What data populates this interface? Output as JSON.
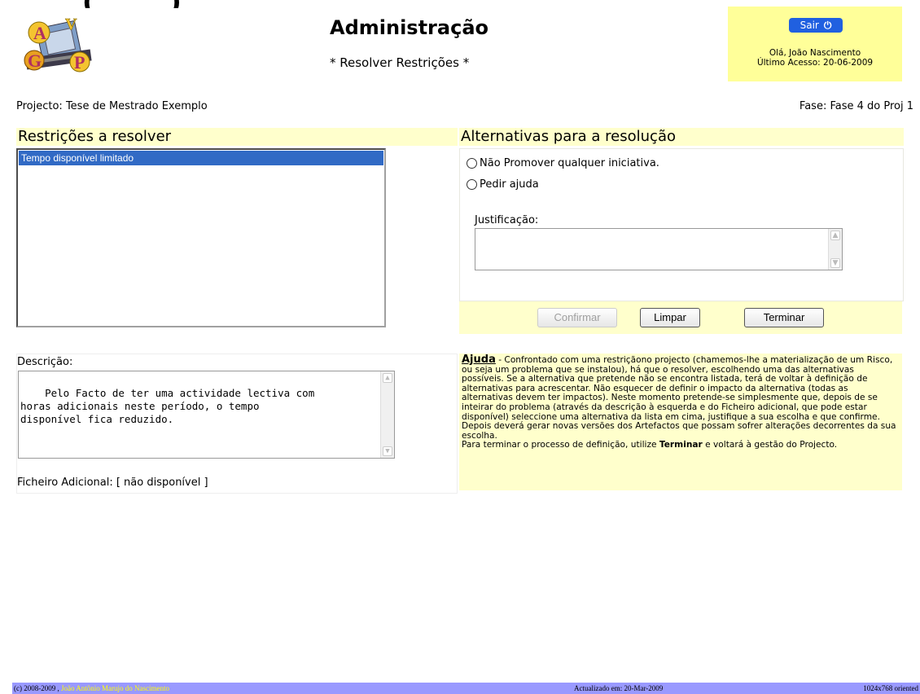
{
  "top_cut_text": "_ (_____)",
  "header": {
    "title": "Administração",
    "subtitle": "* Resolver Restrições *"
  },
  "user": {
    "logout_label": "Sair",
    "greeting": "Olá, João Nascimento",
    "last_access": "Último Acesso: 20-06-2009"
  },
  "project": {
    "label": "Projecto:  Tese de Mestrado Exemplo",
    "phase": "Fase: Fase 4 do Proj 1"
  },
  "restrictions": {
    "heading": "Restrições a resolver",
    "items": [
      "Tempo disponível limitado"
    ]
  },
  "alternatives": {
    "heading": "Alternativas para a resolução",
    "options": [
      "Não Promover qualquer iniciativa.",
      "Pedir ajuda"
    ],
    "justification_label": "Justificação:",
    "justification_value": ""
  },
  "buttons": {
    "confirm": "Confirmar",
    "clear": "Limpar",
    "finish": "Terminar"
  },
  "description": {
    "label": "Descrição:",
    "text": "Pelo Facto de ter uma actividade lectiva com\nhoras adicionais neste período, o tempo\ndisponível fica reduzido.",
    "file_label": "Ficheiro Adicional:  [ não disponível ]"
  },
  "help": {
    "title": "Ajuda",
    "text_part1": " - Confrontado com uma restriçãono projecto (chamemos-lhe a materialização de um Risco, ou seja um problema que se instalou), há que o resolver, escolhendo uma das alternativas possíveis. Se a alternativa que pretende não se encontra listada, terá de voltar à definição de alternativas para acrescentar. Não esquecer de definir o impacto da alternativa (todas as alternativas devem ter impactos). Neste momento pretende-se simplesmente que, depois de se inteirar do problema (através da descrição à esquerda e do Ficheiro adicional, que pode estar disponível) seleccione uma alternativa da lista em cima, justifique a sua escolha e que confirme. Depois deverá gerar novas versões dos Artefactos que possam sofrer alterações decorrentes da sua escolha.",
    "text_part2": "Para terminar o processo de definição, utilize ",
    "finish_word": "Terminar",
    "text_part3": " e voltará à gestão do Projecto."
  },
  "footer": {
    "copyright": "(c) 2008-2009 , ",
    "author": "João Antônio Marujo do Nascimento",
    "updated": "Actualizado em: 20-Mar-2009",
    "resolution": "1024x768 oriented"
  }
}
